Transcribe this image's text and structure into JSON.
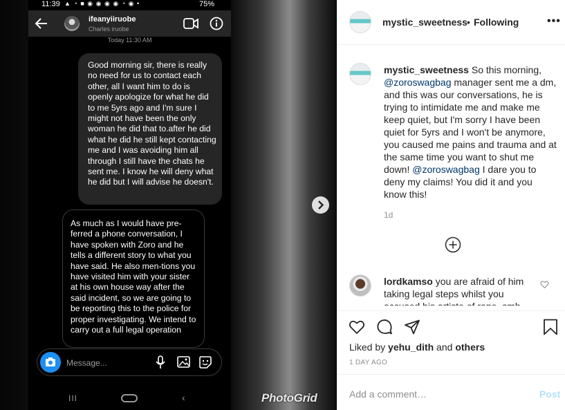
{
  "phone": {
    "status": {
      "time": "11:39",
      "icons": "▲ ◔ ■ ◉ ◉ ◉ ◉ ◔ ◉ •",
      "battery": "75%"
    },
    "chat_header": {
      "username": "ifeanyiiruobe",
      "display_name": "Charles iruobe"
    },
    "today_label": "Today 11:30 AM",
    "sent_message": "Good morning sir, there is really no need for us to contact each other, all I want him to do is openly apologize for what he did to me 5yrs ago and I'm sure I might not have been the only woman he did that to.after he did what he did he still kept contacting me and I was avoiding him all through I still have the chats he sent me. I know he will deny what he did but I will advise he doesn't.",
    "received_message": "As much as I would have pre-ferred a phone conversation, I have spoken with Zoro and he tells a different story to what you have said. He also men-tions you have visited him with your sister at his own house way after the said incident, so we are going to be reporting this to the police for proper investigating. We intend to carry out a full legal operation",
    "composer_placeholder": "Message...",
    "nav_recent": "III",
    "nav_back": "‹"
  },
  "watermark": "PhotoGrid",
  "post": {
    "header": {
      "username": "mystic_sweetness",
      "separator": "•",
      "follow_status": "Following"
    },
    "caption": {
      "username": "mystic_sweetness",
      "part1": " So this morning, ",
      "mention1": "@zoroswagbag",
      "part2": " manager sent me a dm, and this was our conversations, he is trying to intimidate me and make me keep quiet, but I'm sorry I have been quiet for 5yrs and I won't be anymore, you caused me pains and trauma and at the same time you want to shut me down! ",
      "mention2": "@zoroswagbag",
      "part3": " I dare you to deny my claims! You did it and you know this!",
      "time": "1d"
    },
    "comment": {
      "username": "lordkamso",
      "text": " you are afraid of him taking legal steps whilst you accused his artiste of rape..smh"
    },
    "likes": {
      "prefix": "Liked by ",
      "user": "yehu_dith",
      "middle": " and ",
      "others": "others"
    },
    "date": "1 DAY AGO",
    "add_comment": {
      "placeholder": "Add a comment…",
      "post_label": "Post"
    }
  },
  "colors": {
    "link": "#00376b",
    "post_disabled": "#b2dffc",
    "bubble": "#262626",
    "camera_blue": "#1d8ff2"
  },
  "icons": [
    "back-arrow-icon",
    "video-call-icon",
    "info-icon",
    "camera-icon",
    "mic-icon",
    "gallery-icon",
    "sticker-icon",
    "chevron-right-icon",
    "more-icon",
    "plus-circle-icon",
    "heart-icon",
    "comment-icon",
    "share-icon",
    "bookmark-icon"
  ]
}
